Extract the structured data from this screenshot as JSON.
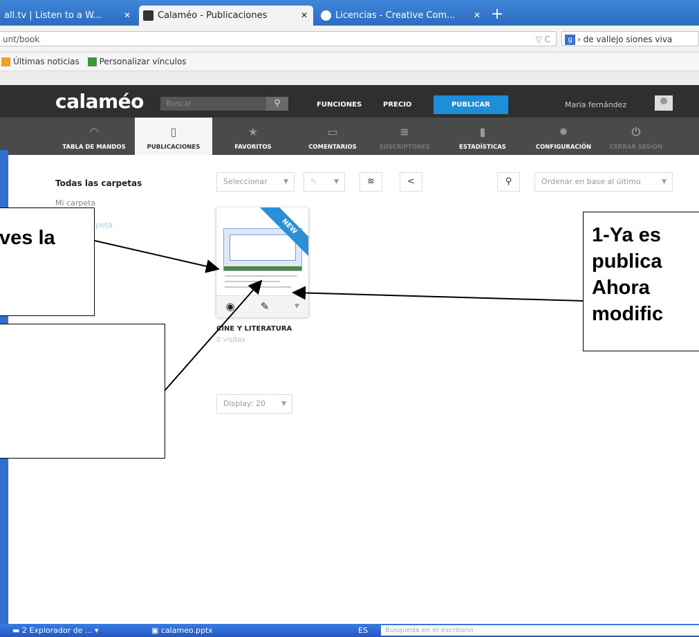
{
  "browser": {
    "tabs": [
      {
        "label": "all.tv | Listen to a W...",
        "active": false
      },
      {
        "label": "Calaméo - Publicaciones",
        "active": true
      },
      {
        "label": "Licencias - Creative Com...",
        "active": false
      }
    ],
    "new_tab_label": "+",
    "url": "unt/book",
    "search_text": "› de vallejo siones viva",
    "bookmarks": [
      "Últimas noticias",
      "Personalizar vínculos"
    ]
  },
  "site": {
    "logo": "calaméo",
    "search_placeholder": "Buscar",
    "nav": {
      "funciones": "FUNCIONES",
      "precio": "PRECIO",
      "publicar": "PUBLICAR"
    },
    "user_name": "Maria fernández",
    "subnav": [
      {
        "label": "TABLA DE MANDOS",
        "icon": "gauge-icon",
        "glyph": "◠",
        "state": "normal"
      },
      {
        "label": "PUBLICACIONES",
        "icon": "document-icon",
        "glyph": "▯",
        "state": "active"
      },
      {
        "label": "FAVORITOS",
        "icon": "star-icon",
        "glyph": "★",
        "state": "normal"
      },
      {
        "label": "COMENTARIOS",
        "icon": "comment-icon",
        "glyph": "▭",
        "state": "normal"
      },
      {
        "label": "SUSCRIPTORES",
        "icon": "subscribers-icon",
        "glyph": "≡",
        "state": "dim"
      },
      {
        "label": "ESTADÍSTICAS",
        "icon": "stats-icon",
        "glyph": "▮",
        "state": "normal"
      },
      {
        "label": "CONFIGURACIÓN",
        "icon": "gear-icon",
        "glyph": "✹",
        "state": "normal"
      },
      {
        "label": "CERRAR SESIÓN",
        "icon": "power-icon",
        "glyph": "⏻",
        "state": "dim"
      }
    ]
  },
  "content": {
    "folders_title": "Todas las carpetas",
    "folder_mine": "Mi carpeta",
    "folder_new": "Nueva carpeta",
    "select_label": "Seleccionar",
    "sort_label": "Ordenar en base al último",
    "display_label": "Display: 20",
    "publication": {
      "badge": "NEW",
      "title": "CINE Y LITERATURA",
      "views": "0 visitas"
    }
  },
  "annotations": {
    "left_top_text": "ves la",
    "right_lines": [
      "1-Ya es",
      "publica",
      "Ahora",
      "modific"
    ]
  },
  "taskbar": {
    "items": [
      "2 Explorador de ...",
      "calameo.pptx"
    ],
    "lang": "ES",
    "desktop_search": "Búsqueda en el escritorio"
  },
  "colors": {
    "publish_button": "#1d8fd8",
    "topbar": "#2f2f2f",
    "subnav": "#4a4a4a",
    "new_badge": "#2c8fd6"
  }
}
